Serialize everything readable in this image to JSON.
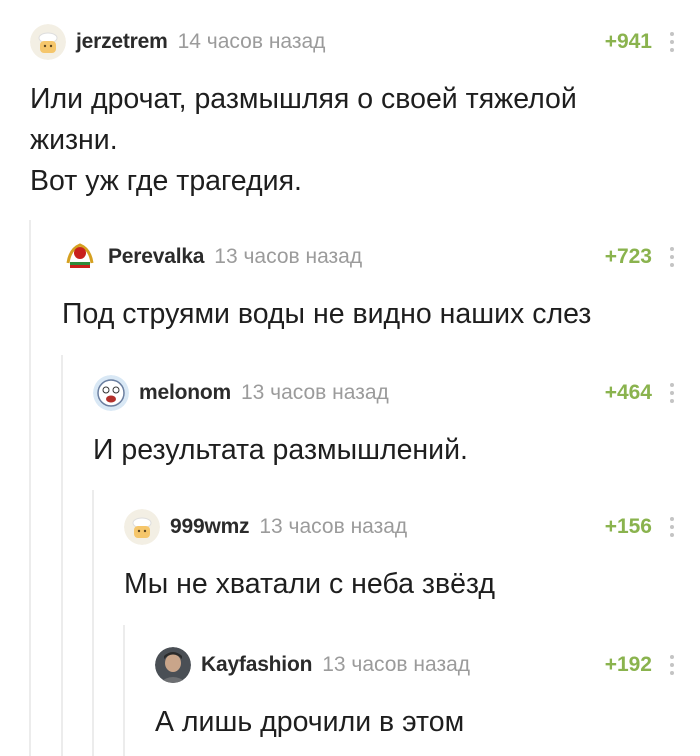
{
  "comments": [
    {
      "username": "jerzetrem",
      "time": "14 часов назад",
      "rating": "+941",
      "avatar_icon": "user-avatar-icon",
      "lines": [
        "Или дрочат, размышляя о своей тяжелой",
        "жизни.",
        "Вот уж где трагедия."
      ]
    },
    {
      "username": "Perevalka",
      "time": "13 часов назад",
      "rating": "+723",
      "avatar_icon": "soviet-emblem-avatar-icon",
      "lines": [
        "Под струями воды не видно наших слез"
      ]
    },
    {
      "username": "melonom",
      "time": "13 часов назад",
      "rating": "+464",
      "avatar_icon": "cartoon-face-avatar-icon",
      "lines": [
        "И результата размышлений."
      ]
    },
    {
      "username": "999wmz",
      "time": "13 часов назад",
      "rating": "+156",
      "avatar_icon": "user-avatar-icon",
      "lines": [
        "Мы не хватали с неба звёзд"
      ]
    },
    {
      "username": "Kayfashion",
      "time": "13 часов назад",
      "rating": "+192",
      "avatar_icon": "photo-avatar-icon",
      "lines": [
        "А лишь дрочили в этом помещении."
      ]
    }
  ],
  "colors": {
    "rating": "#8ab34e",
    "username": "#2b2b2b",
    "time": "#9b9b9b",
    "thread_line": "#ececec"
  }
}
